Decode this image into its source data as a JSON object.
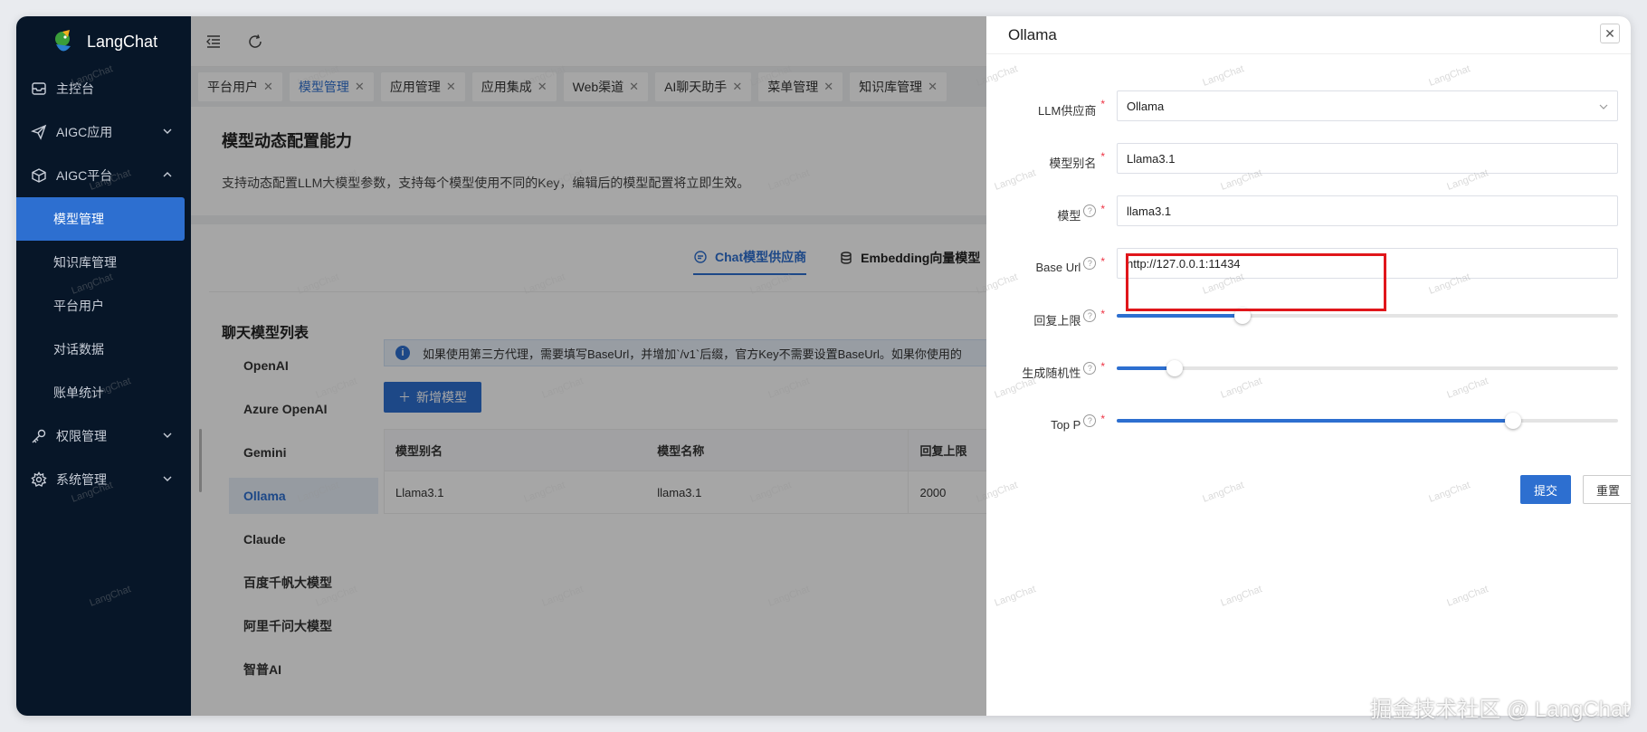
{
  "app": {
    "name": "LangChat"
  },
  "sidebar": {
    "items": [
      {
        "label": "主控台"
      },
      {
        "label": "AIGC应用"
      },
      {
        "label": "AIGC平台"
      },
      {
        "label": "权限管理"
      },
      {
        "label": "系统管理"
      }
    ],
    "sub_items": [
      {
        "label": "模型管理"
      },
      {
        "label": "知识库管理"
      },
      {
        "label": "平台用户"
      },
      {
        "label": "对话数据"
      },
      {
        "label": "账单统计"
      }
    ]
  },
  "tabs": [
    {
      "label": "平台用户"
    },
    {
      "label": "模型管理"
    },
    {
      "label": "应用管理"
    },
    {
      "label": "应用集成"
    },
    {
      "label": "Web渠道"
    },
    {
      "label": "AI聊天助手"
    },
    {
      "label": "菜单管理"
    },
    {
      "label": "知识库管理"
    }
  ],
  "page": {
    "title": "模型动态配置能力",
    "description": "支持动态配置LLM大模型参数，支持每个模型使用不同的Key，编辑后的模型配置将立即生效。"
  },
  "content_tabs": [
    {
      "label": "Chat模型供应商"
    },
    {
      "label": "Embedding向量模型"
    }
  ],
  "provider_list": {
    "title": "聊天模型列表",
    "items": [
      "OpenAI",
      "Azure OpenAI",
      "Gemini",
      "Ollama",
      "Claude",
      "百度千帆大模型",
      "阿里千问大模型",
      "智普AI"
    ]
  },
  "alert": {
    "text": "如果使用第三方代理，需要填写BaseUrl，并增加`/v1`后缀，官方Key不需要设置BaseUrl。如果你使用的"
  },
  "add_button": {
    "label": "新增模型"
  },
  "table": {
    "headers": [
      "模型别名",
      "模型名称",
      "回复上限"
    ],
    "rows": [
      [
        "Llama3.1",
        "llama3.1",
        "2000"
      ]
    ]
  },
  "drawer": {
    "title": "Ollama",
    "fields": {
      "provider": {
        "label": "LLM供应商",
        "value": "Ollama"
      },
      "alias": {
        "label": "模型别名",
        "value": "Llama3.1"
      },
      "model": {
        "label": "模型",
        "value": "llama3.1"
      },
      "base_url": {
        "label": "Base Url",
        "value": "http://127.0.0.1:11434"
      },
      "max_tokens": {
        "label": "回复上限",
        "value_fraction": 0.25
      },
      "temperature": {
        "label": "生成随机性",
        "value_fraction": 0.115
      },
      "top_p": {
        "label": "Top P",
        "value_fraction": 0.79
      }
    },
    "submit_label": "提交",
    "reset_label": "重置"
  },
  "watermark": {
    "text": "LangChat"
  },
  "footer_watermark": {
    "text": "掘金技术社区 @ LangChat"
  },
  "colors": {
    "primary": "#2d6fd0",
    "sidebar_bg": "#071628",
    "highlight": "#e0161b"
  }
}
